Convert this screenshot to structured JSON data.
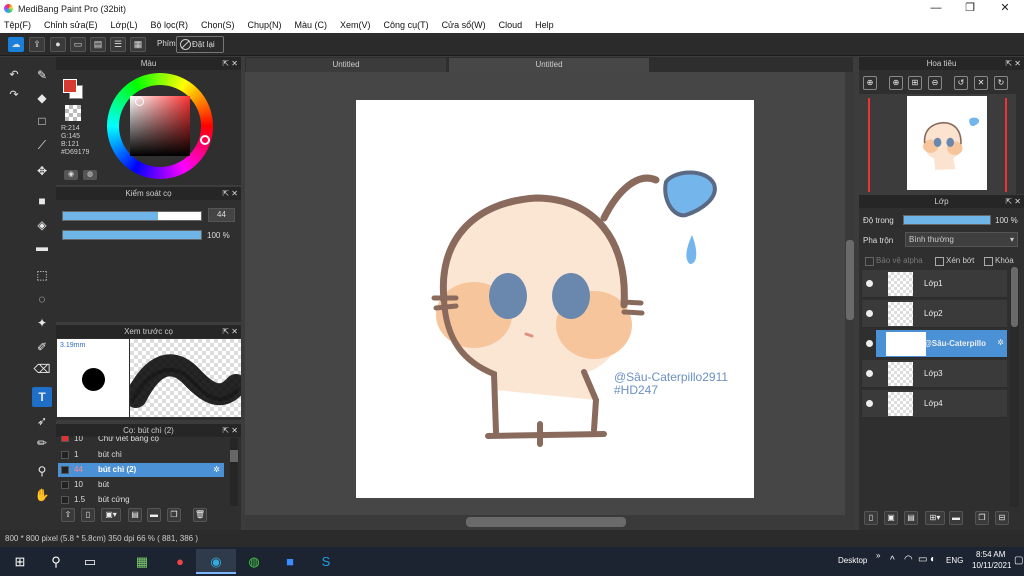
{
  "window": {
    "title": "MediBang Paint Pro (32bit)",
    "minimize": "—",
    "maximize": "❐",
    "close": "✕"
  },
  "menu": [
    "Tệp(F)",
    "Chỉnh sửa(E)",
    "Lớp(L)",
    "Bộ lọc(R)",
    "Chọn(S)",
    "Chụp(N)",
    "Màu (C)",
    "Xem(V)",
    "Công cụ(T)",
    "Cửa sổ(W)",
    "Cloud",
    "Help"
  ],
  "toolbar": {
    "shortcut_label": "Phím",
    "reset_label": "Đặt lại"
  },
  "color_panel": {
    "title": "Màu",
    "r": "R:214",
    "g": "G:145",
    "b": "B:121",
    "hex": "#D69179",
    "fg": "#d63b32"
  },
  "brush_control": {
    "title": "Kiểm soát cọ",
    "size": "44",
    "size_fraction": 0.69,
    "opacity": "100 %",
    "opacity_fraction": 1.0
  },
  "brush_preview": {
    "title": "Xem trước cọ",
    "size_label": "3.19mm"
  },
  "brush_list": {
    "title": "Cọ: bút chì (2)",
    "rows": [
      {
        "num": "10",
        "name": "Chữ viết bằng cọ"
      },
      {
        "num": "1",
        "name": "bút chì"
      },
      {
        "num": "44",
        "name": "bút chì (2)"
      },
      {
        "num": "10",
        "name": "bút"
      },
      {
        "num": "1.5",
        "name": "bút cứng"
      }
    ]
  },
  "tabs": [
    "Untitled",
    "Untitled"
  ],
  "canvas": {
    "watermark_line1": "@Sâu-Caterpillo2911",
    "watermark_line2": "#HD247"
  },
  "navigator": {
    "title": "Hoa tiêu"
  },
  "layers": {
    "title": "Lớp",
    "opacity_label": "Độ trong",
    "opacity_value": "100 %",
    "opacity_fraction": 1.0,
    "blend_label": "Pha trộn",
    "blend_value": "Bình thường",
    "protect_alpha": "Bảo vệ alpha",
    "clipping": "Xén bớt",
    "lock": "Khóa",
    "items": [
      {
        "name": "Lớp1"
      },
      {
        "name": "Lớp2"
      },
      {
        "name": "@Sâu-Caterpillo"
      },
      {
        "name": "Lớp3"
      },
      {
        "name": "Lớp4"
      }
    ]
  },
  "status": {
    "text": "800 * 800 pixel  (5.8 * 5.8cm)  350 dpi  66 %  ( 881, 386 )"
  },
  "taskbar": {
    "desktop": "Desktop",
    "language": "ENG",
    "time": "8:54 AM",
    "date": "10/11/2021"
  },
  "colors": {
    "accent": "#4a91d6",
    "slider": "#6fb5e8"
  }
}
